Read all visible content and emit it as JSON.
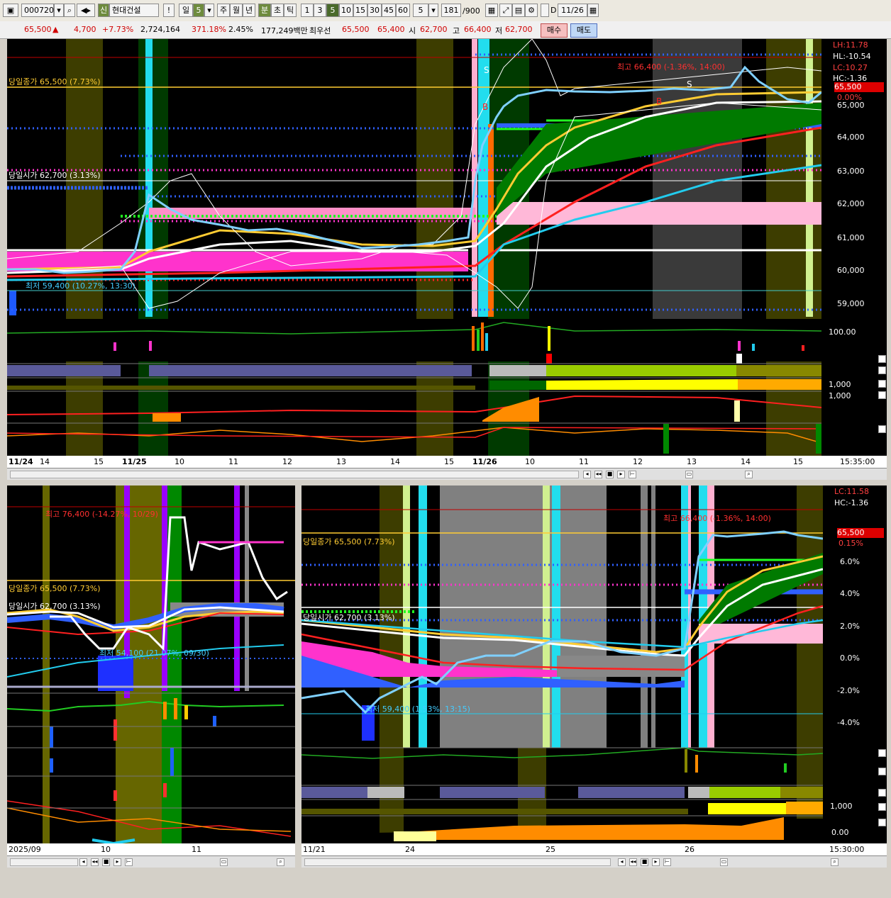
{
  "toolbar": {
    "code": "000720",
    "badge": "신",
    "name": "현대건설",
    "bang": "!",
    "period_il": "일",
    "period_5": "5",
    "ju": "주",
    "wol": "월",
    "nyeon": "년",
    "bun": "분",
    "cho": "초",
    "tik": "틱",
    "intervals": [
      "1",
      "3",
      "5",
      "10",
      "15",
      "30",
      "45",
      "60"
    ],
    "interval_sel": "5",
    "count": "181",
    "count_total": "/900",
    "d_label": "D",
    "date": "11/26"
  },
  "quote": {
    "price": "65,500",
    "arrow": "▲",
    "change": "4,700",
    "change_pct": "+7.73%",
    "volume": "2,724,164",
    "vol_ratio": "371.18%",
    "turnover": "2.45%",
    "amount": "177,249백만",
    "prior_label": "최우선",
    "ask": "65,500",
    "bid": "65,400",
    "open_label": "시",
    "open": "62,700",
    "high_label": "고",
    "high": "66,400",
    "low_label": "저",
    "low": "62,700",
    "buy": "매수",
    "sell": "매도"
  },
  "main_chart": {
    "close_label": "당일종가 65,500 (7.73%)",
    "open_label": "당일시가 62,700 (3.13%)",
    "high_label": "최고 66,400 (-1.36%, 14:00)",
    "low_label": "최저 59,400 (10.27%, 13:30)",
    "price_tag": "65,500",
    "pct_tag": "0.00%",
    "info": [
      "LH:11.78",
      "HL:-10.54",
      "LC:10.27",
      "HC:-1.36"
    ],
    "y_ticks": [
      "65,000",
      "64,000",
      "63,000",
      "62,000",
      "61,000",
      "60,000",
      "59,000"
    ],
    "vol_tick": "100.00",
    "sub_ticks": [
      "1,000",
      "1,000"
    ],
    "x_labels": [
      "11/24",
      "14",
      "15",
      "11/25",
      "10",
      "11",
      "12",
      "13",
      "14",
      "15",
      "11/26",
      "10",
      "11",
      "12",
      "13",
      "14",
      "15"
    ],
    "time": "15:35:00"
  },
  "left_chart": {
    "high_label": "최고 76,400 (-14.27%, 10/29)",
    "close_label": "당일종가 65,500 (7.73%)",
    "open_label": "당일시가 62,700 (3.13%)",
    "low_label": "최저 54,100 (21.07%, 09/30)",
    "x_labels": [
      "2025/09",
      "10",
      "11"
    ]
  },
  "right_chart": {
    "info": [
      "LC:11.58",
      "HC:-1.36"
    ],
    "high_label": "최고 66,400 (-1.36%, 14:00)",
    "close_label": "당일종가 65,500 (7.73%)",
    "open_label": "당일시가 62,700 (3.13%)",
    "low_label": "최저 59,400 (1.53%, 13:15)",
    "price_tag": "65,500",
    "pct_tag": "0.15%",
    "y_ticks": [
      "6.0%",
      "4.0%",
      "2.0%",
      "0.0%",
      "-2.0%",
      "-4.0%"
    ],
    "sub_ticks": [
      "1,000",
      "0.00"
    ],
    "x_labels": [
      "11/21",
      "24",
      "25",
      "26"
    ],
    "time": "15:30:00"
  }
}
